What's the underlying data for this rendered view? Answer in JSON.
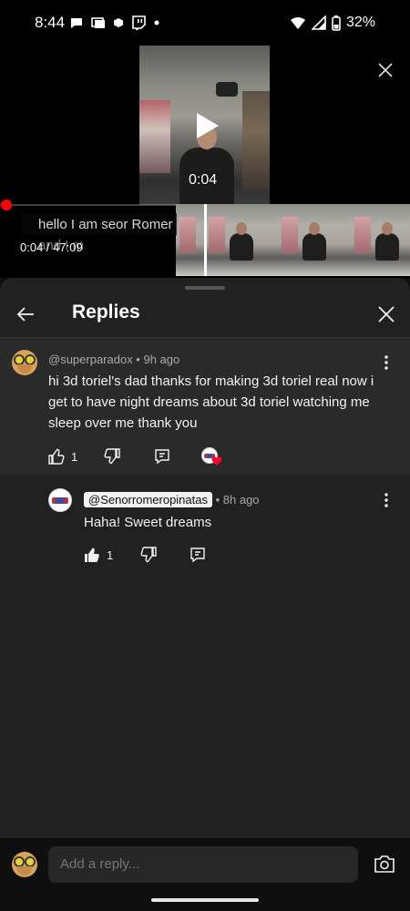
{
  "status_bar": {
    "time": "8:44",
    "battery": "32%",
    "left_icons": [
      "chat-bubble-icon",
      "photos-icon",
      "hexagon-icon",
      "twitch-icon",
      "dot-icon"
    ],
    "right_icons": [
      "wifi-icon",
      "signal-icon",
      "battery-icon"
    ]
  },
  "player": {
    "overlay_time": "0:04",
    "current_time": "0:04",
    "duration": "47:09",
    "time_display": "0:04 / 47:09",
    "progress_fraction": 0.0014,
    "caption_line1": "hello I am seor Romer",
    "caption_line2": "and I m",
    "accent_color": "#ff0000"
  },
  "replies_sheet": {
    "title": "Replies",
    "parent": {
      "author": "@superparadox",
      "age": "9h ago",
      "meta": "@superparadox • 9h ago",
      "text": "hi 3d toriel's dad thanks for making 3d toriel real now i get to have night dreams about 3d toriel watching me sleep over me thank you",
      "likes": "1",
      "hearted_by_creator": true
    },
    "reply": {
      "author": "@Senorromeropinatas",
      "age": "• 8h ago",
      "text": "Haha! Sweet dreams",
      "likes": "1",
      "liked": true
    }
  },
  "composer": {
    "placeholder": "Add a reply..."
  }
}
